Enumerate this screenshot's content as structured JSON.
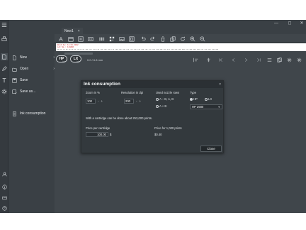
{
  "window": {
    "minimize_glyph": "—",
    "maximize_glyph": "◻",
    "close_glyph": "✕"
  },
  "document_tab": {
    "label": "New1",
    "close_glyph": "×"
  },
  "file_menu": {
    "items": [
      {
        "label": "New",
        "icon": "new-file-icon",
        "has_submenu": true
      },
      {
        "label": "Open",
        "icon": "open-folder-icon",
        "has_submenu": true
      },
      {
        "label": "Save",
        "icon": "save-icon",
        "has_submenu": false
      },
      {
        "label": "Save as...",
        "icon": "save-as-icon",
        "has_submenu": false
      },
      {
        "label": "Ink consumption",
        "icon": "ink-consumption-icon",
        "has_submenu": false
      }
    ],
    "chevron_glyph": "›"
  },
  "label_preview": {
    "line1": "Best by: 12.01.2022",
    "line2": "Lot No.: 123ABC",
    "ruler": "mm   10 20 30 40 50 60 70 80 90 100 110 120 130 140 150 160 170 180 190 200 210 220 230 240 250 260 270 280 290 300 310 320 330 340 350 360 370 380 390 400 410 420 430 440 450"
  },
  "work_area": {
    "printer_hp": "HP",
    "printer_lx": "LX",
    "printer_small": "Inkjet",
    "size_text": "0.0 / 6.8 mm"
  },
  "dialog": {
    "title": "Ink consumption",
    "close_glyph": "×",
    "zoom_label": "Zoom in %",
    "zoom_value": "100",
    "resolution_label": "Resolution in dpi",
    "resolution_value": "200",
    "spin_minus": "-",
    "spin_plus": "+",
    "nozzle_label": "Used nozzle rows",
    "nozzle_opt1": "A – B, A, B",
    "nozzle_opt2": "A + B",
    "type_label": "Type",
    "type_opt_hp": "HP",
    "type_opt_lx": "LX",
    "cartridge_select": "HP 2580",
    "prints_text": "With a cartridge can be done about 253,000 prints.",
    "price_label": "Price per cartridge",
    "price_value": "100.00",
    "currency": "$",
    "price_per_label": "Price for 1,000 prints",
    "price_per_value": "$0.40",
    "close_button": "Close"
  },
  "colors": {
    "background": "#3a4045",
    "panel": "#40464b",
    "dialog": "#33393d",
    "accent_red": "#cc2222"
  }
}
